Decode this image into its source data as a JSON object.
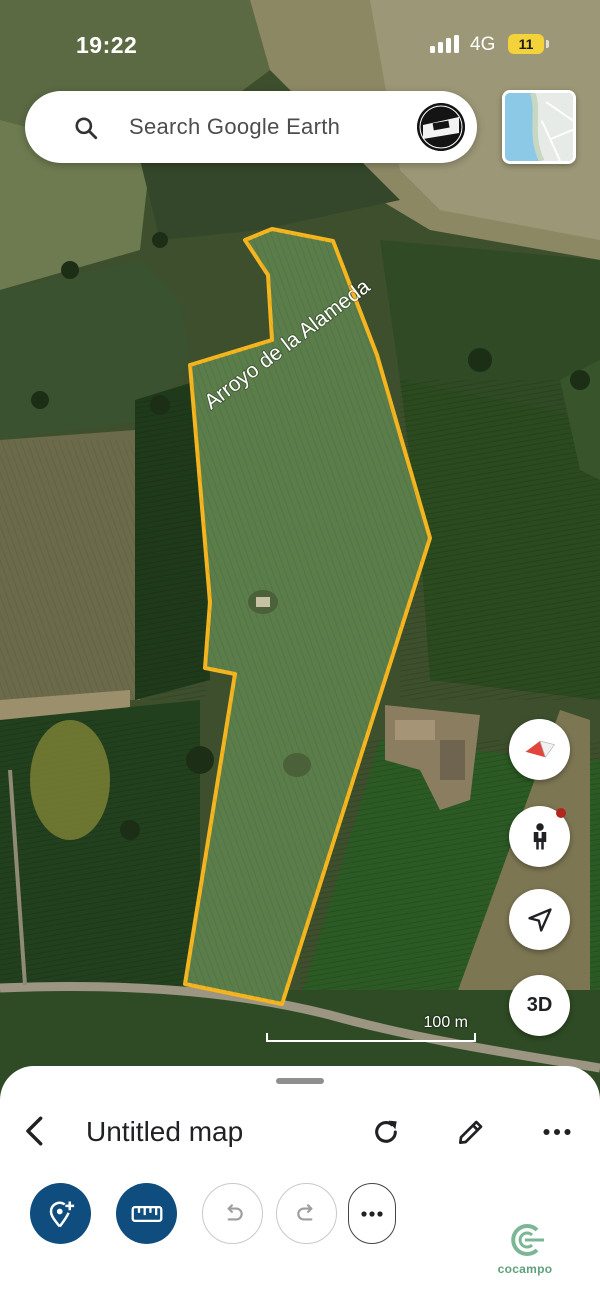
{
  "status_bar": {
    "time": "19:22",
    "network": "4G",
    "battery": "11"
  },
  "search": {
    "placeholder": "Search Google Earth"
  },
  "map": {
    "field_label": "Arroyo de la Alameda",
    "scale_label": "100 m",
    "boundary_color": "#f5b51f"
  },
  "side_controls": {
    "three_d_label": "3D"
  },
  "bottom_sheet": {
    "title": "Untitled map"
  },
  "brand": {
    "name": "cocampo"
  },
  "icons": [
    "search-icon",
    "compass-icon",
    "street-view-person-icon",
    "my-location-icon",
    "back-icon",
    "refresh-icon",
    "edit-pencil-icon",
    "more-horizontal-icon",
    "add-placemark-icon",
    "ruler-icon",
    "undo-icon",
    "redo-icon"
  ]
}
